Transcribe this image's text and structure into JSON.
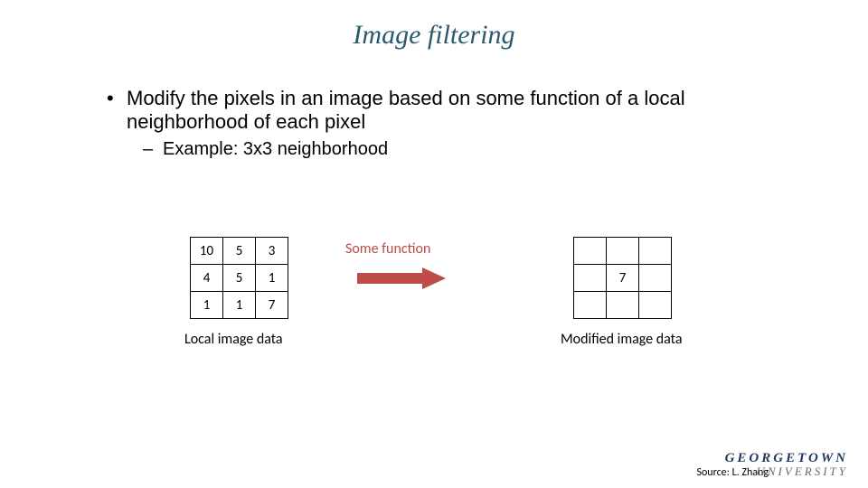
{
  "title": "Image filtering",
  "bullet1": "Modify the pixels in an image based on some function of a local neighborhood of each pixel",
  "bullet2": "Example:   3x3 neighborhood",
  "func_label": "Some function",
  "local_grid": [
    [
      "10",
      "5",
      "3"
    ],
    [
      "4",
      "5",
      "1"
    ],
    [
      "1",
      "1",
      "7"
    ]
  ],
  "modified_grid": [
    [
      "",
      "",
      ""
    ],
    [
      "",
      "7",
      ""
    ],
    [
      "",
      "",
      ""
    ]
  ],
  "caption_left": "Local image data",
  "caption_right": "Modified image data",
  "logo_line1": "GEORGETOWN",
  "logo_line2": "UNIVERSITY",
  "source": "Source: L. Zhang",
  "colors": {
    "title": "#2b5a6f",
    "accent": "#be4b48"
  }
}
